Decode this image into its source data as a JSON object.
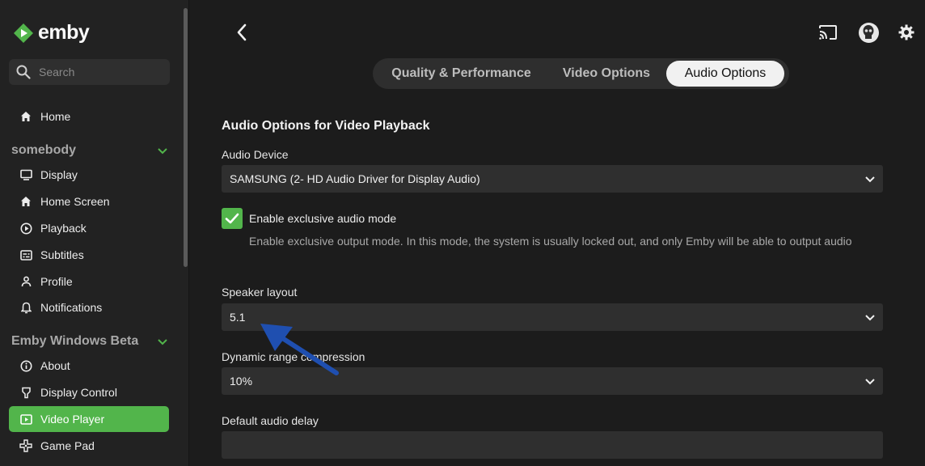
{
  "app": {
    "logo_text": "emby"
  },
  "search": {
    "placeholder": "Search"
  },
  "sidebar": {
    "home_label": "Home",
    "section1": {
      "title": "somebody",
      "items": [
        "Display",
        "Home Screen",
        "Playback",
        "Subtitles",
        "Profile",
        "Notifications"
      ]
    },
    "section2": {
      "title": "Emby Windows Beta",
      "items": [
        "About",
        "Display Control",
        "Video Player",
        "Game Pad"
      ]
    },
    "active_item": "Video Player"
  },
  "tabs": [
    {
      "label": "Quality & Performance",
      "active": false
    },
    {
      "label": "Video Options",
      "active": false
    },
    {
      "label": "Audio Options",
      "active": true
    }
  ],
  "content": {
    "title": "Audio Options for Video Playback",
    "audio_device": {
      "label": "Audio Device",
      "value": "SAMSUNG (2- HD Audio Driver for Display Audio)"
    },
    "exclusive_mode": {
      "label": "Enable exclusive audio mode",
      "checked": true,
      "description": "Enable exclusive output mode. In this mode, the system is usually locked out, and only Emby will be able to output audio"
    },
    "speaker_layout": {
      "label": "Speaker layout",
      "value": "5.1"
    },
    "drc": {
      "label": "Dynamic range compression",
      "value": "10%"
    },
    "audio_delay": {
      "label": "Default audio delay",
      "value": ""
    }
  },
  "colors": {
    "accent": "#52b54b",
    "background": "#1c1c1c",
    "sidebar": "#222222",
    "field": "#2f2f2f",
    "annotation_arrow": "#1f4fb0"
  }
}
